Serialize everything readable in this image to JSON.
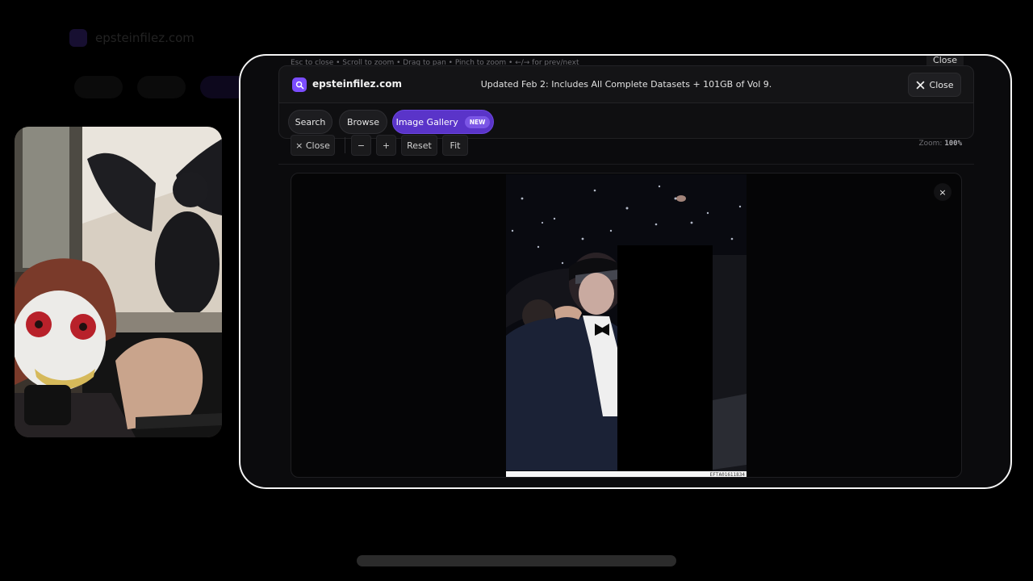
{
  "window": {
    "brand": "epsteinfilez.com",
    "update_banner": "Updated Feb 2: Includes All Complete Datasets + 101GB of Vol 9.",
    "close_label": "Close",
    "underlay_hint": "Esc to close • Scroll to zoom • Drag to pan • Pinch to zoom • ←/→ for prev/next",
    "underlay_close": "Close"
  },
  "nav": {
    "tabs": [
      {
        "label": "Search"
      },
      {
        "label": "Browse"
      },
      {
        "label": "Image Gallery",
        "badge": "NEW",
        "active": true
      }
    ]
  },
  "toolbar": {
    "close_label": "× Close",
    "zoom_out": "−",
    "zoom_in": "+",
    "reset": "Reset",
    "fit": "Fit",
    "zoom_label": "Zoom:",
    "zoom_value": "100%"
  },
  "viewer": {
    "close_glyph": "×",
    "file_label": "EFTA01611834"
  },
  "colors": {
    "accent": "#5a34c9",
    "badge": "#7b56e6",
    "brand_icon": "#7b4dff"
  },
  "icons": {
    "brand": "search-icon",
    "close": "close-icon"
  }
}
